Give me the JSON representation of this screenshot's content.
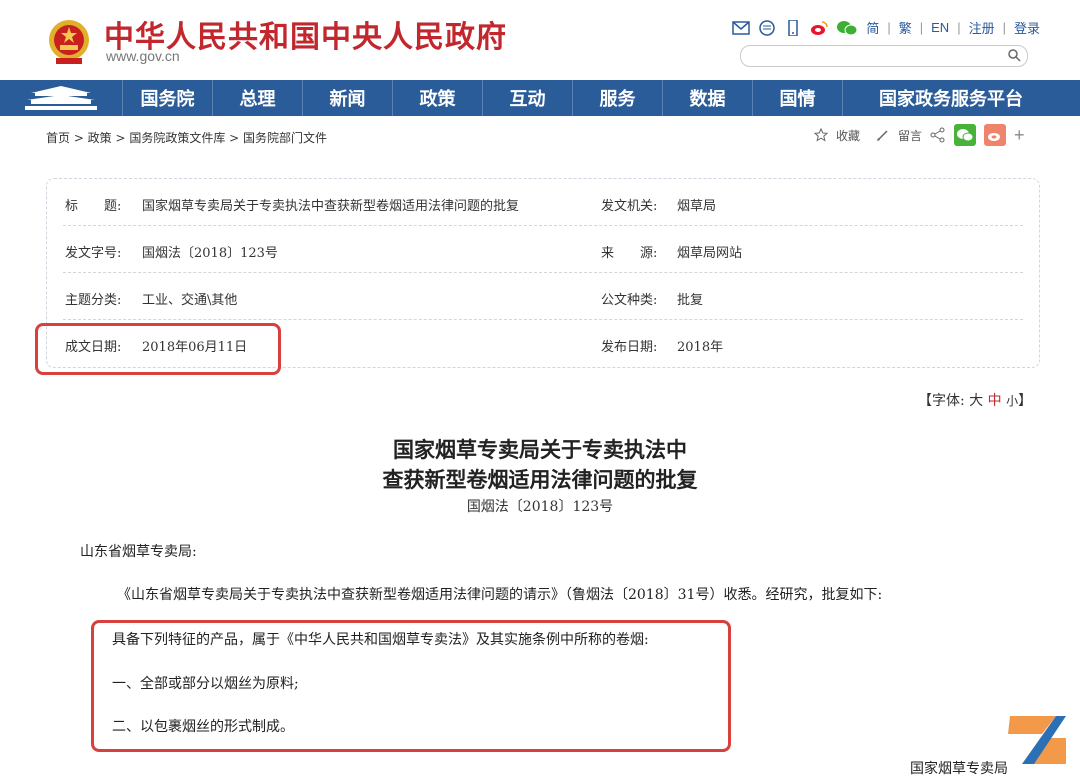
{
  "header": {
    "site_title": "中华人民共和国中央人民政府",
    "site_domain": "www.gov.cn",
    "links": [
      "简",
      "繁",
      "EN",
      "注册",
      "登录"
    ]
  },
  "nav": [
    "国务院",
    "总理",
    "新闻",
    "政策",
    "互动",
    "服务",
    "数据",
    "国情",
    "国家政务服务平台"
  ],
  "breadcrumb": "首页 > 政策 > 国务院政策文件库 > 国务院部门文件",
  "share": {
    "favorite": "收藏",
    "comment": "留言",
    "plus": "+"
  },
  "info": {
    "title_label": "标　　题:",
    "title_value": "国家烟草专卖局关于专卖执法中查获新型卷烟适用法律问题的批复",
    "issuer_label": "发文机关:",
    "issuer_value": "烟草局",
    "docno_label": "发文字号:",
    "docno_value": "国烟法〔2018〕123号",
    "source_label": "来　　源:",
    "source_value": "烟草局网站",
    "topic_label": "主题分类:",
    "topic_value": "工业、交通\\其他",
    "type_label": "公文种类:",
    "type_value": "批复",
    "date_label": "成文日期:",
    "date_value": "2018年06月11日",
    "pub_label": "发布日期:",
    "pub_value": "2018年"
  },
  "font_size": {
    "prefix": "【字体:",
    "large": "大",
    "medium": "中",
    "small": "小",
    "suffix": "】"
  },
  "document": {
    "title_line1": "国家烟草专卖局关于专卖执法中",
    "title_line2": "查获新型卷烟适用法律问题的批复",
    "number": "国烟法〔2018〕123号",
    "addressee": "山东省烟草专卖局:",
    "para1": "《山东省烟草专卖局关于专卖执法中查获新型卷烟适用法律问题的请示》（鲁烟法〔2018〕31号）收悉。经研究，批复如下:",
    "para2": "具备下列特征的产品，属于《中华人民共和国烟草专卖法》及其实施条例中所称的卷烟:",
    "item1": "一、全部或部分以烟丝为原料;",
    "item2": "二、以包裹烟丝的形式制成。",
    "signature": "国家烟草专卖局"
  },
  "colors": {
    "brand_red": "#c1272d",
    "nav_blue": "#2a5c9a",
    "highlight_red": "#d8403d"
  }
}
